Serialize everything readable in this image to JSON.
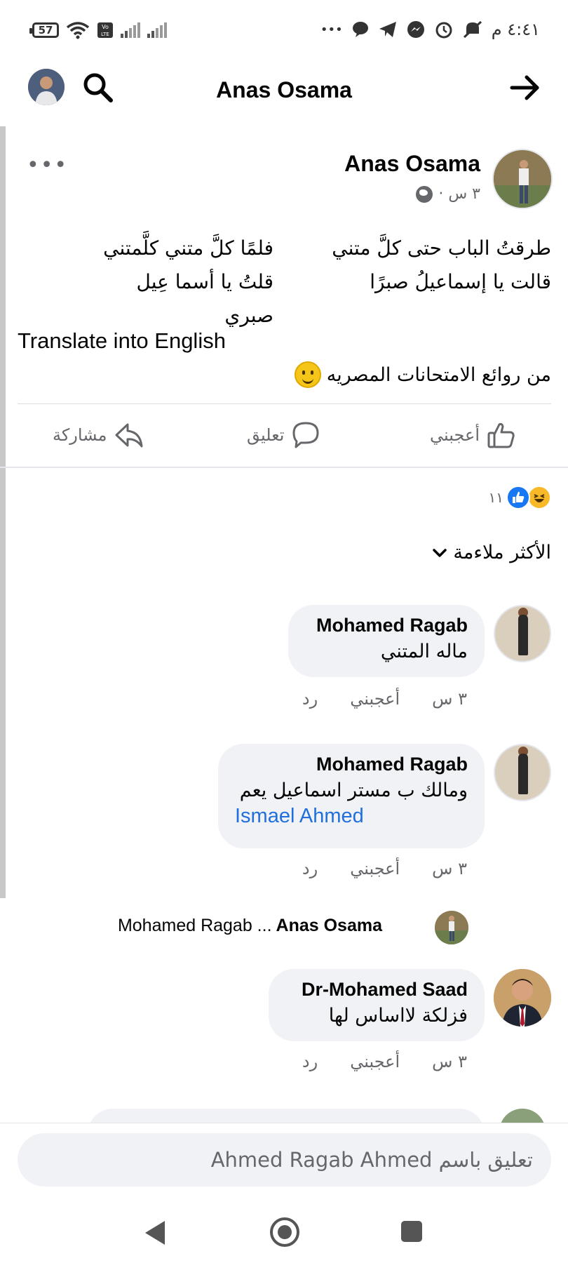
{
  "status_bar": {
    "battery": "57",
    "time": "٤:٤١ م",
    "overflow": "•••"
  },
  "header": {
    "title": "Anas Osama"
  },
  "post": {
    "author": "Anas Osama",
    "time": "٣ س ·",
    "more": "•••",
    "poem_right": [
      "طرقتُ الباب حتى كلَّ متني",
      "قالت يا إسماعيلُ صبرًا"
    ],
    "poem_left": [
      "فلمًا كلَّ متني كلَّمتني",
      "قلتُ يا أسما عِيل صبري"
    ],
    "translate_label": "Translate into English",
    "caption": "من روائع الامتحانات المصريه",
    "actions": {
      "like": "أعجبني",
      "comment": "تعليق",
      "share": "مشاركة"
    },
    "reaction_count": "١١",
    "sort_label": "الأكثر ملاءمة"
  },
  "comments": [
    {
      "name": "Mohamed Ragab",
      "text": "ماله المتني",
      "time": "٣ س",
      "like": "أعجبني",
      "reply": "رد"
    },
    {
      "name": "Mohamed Ragab",
      "text": "ومالك ب مستر اسماعيل يعم",
      "mention": "Ismael Ahmed",
      "time": "٣ س",
      "like": "أعجبني",
      "reply": "رد"
    },
    {
      "name": "Dr-Mohamed Saad",
      "text": "فزلكة لااساس لها",
      "time": "٣ س",
      "like": "أعجبني",
      "reply": "رد"
    }
  ],
  "reply_preview": {
    "author": "Anas Osama",
    "text": "Mohamed Ragab ..."
  },
  "composer": {
    "placeholder": "تعليق باسم Ahmed Ragab Ahmed"
  },
  "colors": {
    "link": "#216fdb",
    "bubble": "#f0f2f5",
    "muted": "#65676b",
    "like_blue": "#1877f2"
  }
}
